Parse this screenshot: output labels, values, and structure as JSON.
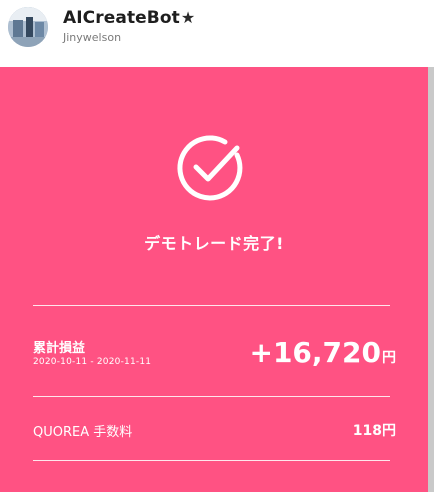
{
  "header": {
    "user_name": "AICreateBot",
    "star": "★",
    "user_handle": "Jinywelson"
  },
  "card": {
    "title": "デモトレード完了!",
    "pl_label": "累計損益",
    "date_range": "2020-10-11 - 2020-11-11",
    "pl_value": "+16,720",
    "currency": "円",
    "fee_label": "QUOREA 手数料",
    "fee_value": "118円"
  },
  "colors": {
    "card_bg": "#ff5283",
    "text_on_card": "#ffffff"
  },
  "icons": {
    "avatar": "avatar-image",
    "check": "check-circle-icon",
    "star": "star-icon"
  }
}
